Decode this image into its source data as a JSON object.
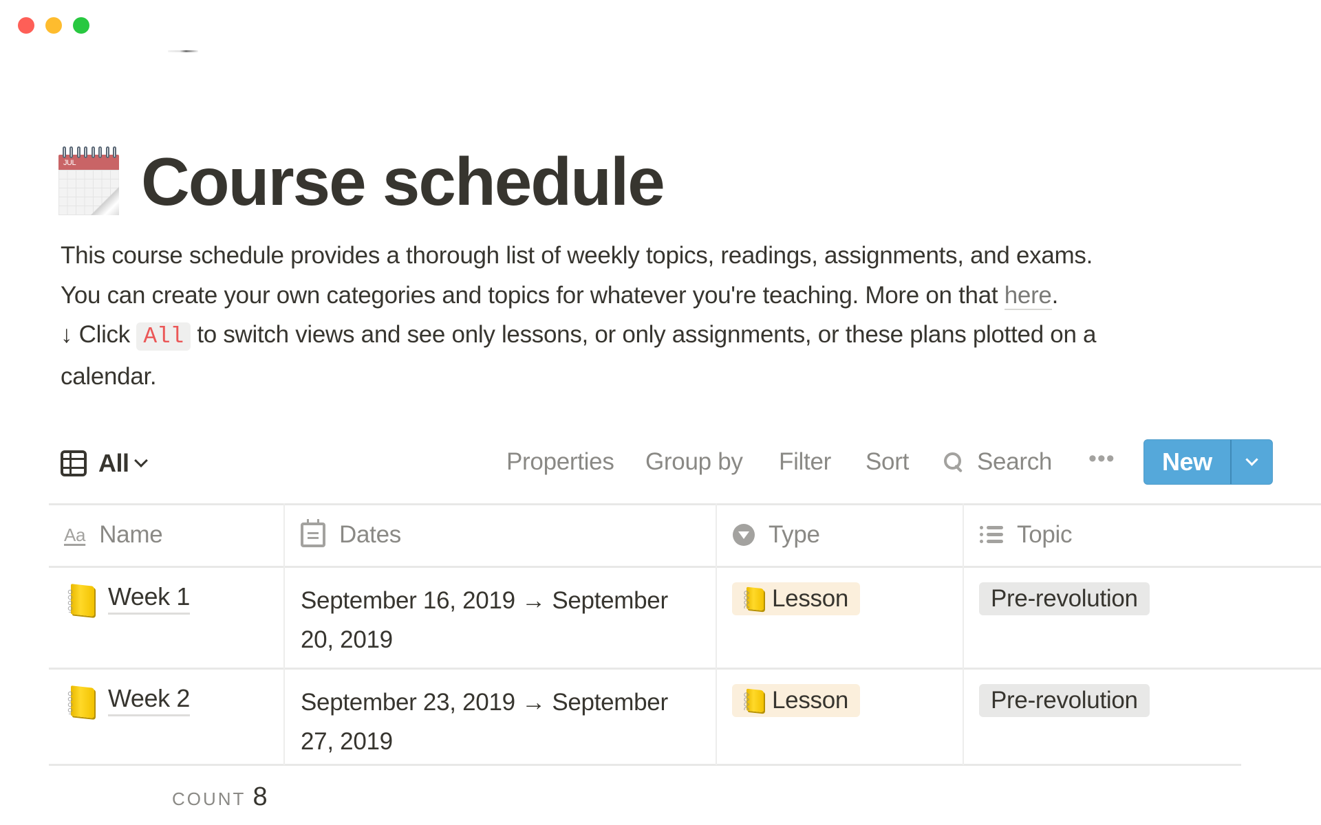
{
  "window": {
    "traffic_lights": [
      "close",
      "minimize",
      "zoom"
    ]
  },
  "page": {
    "icon": "calendar-icon",
    "icon_month": "JUL",
    "title": "Course schedule",
    "description": {
      "line1": "This course schedule provides a thorough list of weekly topics, readings, assignments, and exams.",
      "line2_prefix": "You can create your own categories and topics for whatever you're teaching. More on that ",
      "line2_link": "here",
      "line2_suffix": ".",
      "line3_prefix": "↓ Click ",
      "line3_code": "All",
      "line3_suffix": " to switch views and see only lessons, or only assignments, or these plans plotted on a",
      "line4": "calendar."
    }
  },
  "toolbar": {
    "view_label": "All",
    "view_icon": "table-icon",
    "properties": "Properties",
    "group_by": "Group by",
    "filter": "Filter",
    "sort": "Sort",
    "search": "Search",
    "more": "•••",
    "new_label": "New",
    "new_button_color": "#55a8da"
  },
  "table": {
    "columns": [
      {
        "label": "Name",
        "icon": "text-property-icon"
      },
      {
        "label": "Dates",
        "icon": "calendar-property-icon"
      },
      {
        "label": "Type",
        "icon": "select-property-icon"
      },
      {
        "label": "Topic",
        "icon": "multi-select-property-icon"
      }
    ],
    "rows": [
      {
        "name": "Week 1",
        "icon": "notebook-icon",
        "dates_line1": "September 16, 2019 → September",
        "dates_line2": "20, 2019",
        "type": "Lesson",
        "topic": "Pre-revolution"
      },
      {
        "name": "Week 2",
        "icon": "notebook-icon",
        "dates_line1": "September 23, 2019 → September",
        "dates_line2": "27, 2019",
        "type": "Lesson",
        "topic": "Pre-revolution"
      }
    ],
    "footer": {
      "count_label": "COUNT",
      "count_value": "8"
    },
    "colors": {
      "lesson_tag_bg": "#fbefdc",
      "topic_tag_bg": "#e8e8e7"
    }
  }
}
